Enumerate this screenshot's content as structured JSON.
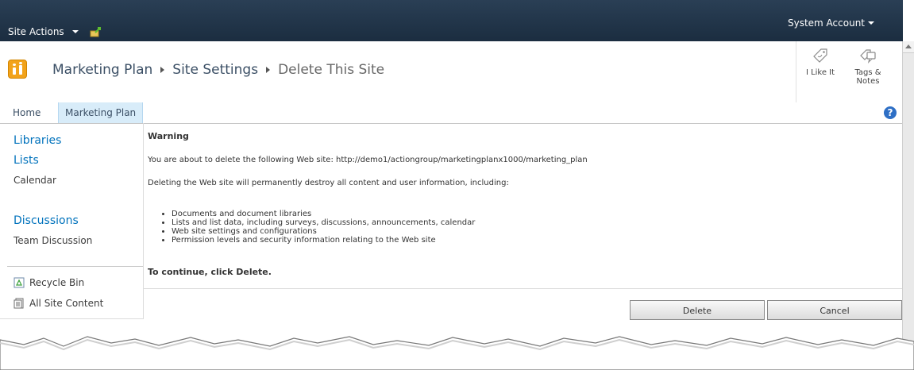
{
  "topbar": {
    "site_actions": "Site Actions",
    "user": "System Account"
  },
  "title": {
    "breadcrumb": [
      "Marketing Plan",
      "Site Settings",
      "Delete This Site"
    ],
    "social": {
      "like": "I Like It",
      "tags_line1": "Tags &",
      "tags_line2": "Notes"
    }
  },
  "topnav": {
    "tabs": [
      "Home",
      "Marketing Plan"
    ],
    "help": "?"
  },
  "leftnav": {
    "libraries": "Libraries",
    "lists": "Lists",
    "calendar": "Calendar",
    "discussions": "Discussions",
    "team_discussion": "Team Discussion",
    "recycle_bin": "Recycle Bin",
    "all_site_content": "All Site Content"
  },
  "main": {
    "warning_title": "Warning",
    "about_to_delete": "You are about to delete the following Web site: http://demo1/actiongroup/marketingplanx1000/marketing_plan",
    "permanently": "Deleting the Web site will permanently destroy all content and user information, including:",
    "bullets": [
      "Documents and document libraries",
      "Lists and list data, including surveys, discussions, announcements, calendar",
      "Web site settings and configurations",
      "Permission levels and security information relating to the Web site"
    ],
    "continue": "To continue, click Delete.",
    "delete_label": "Delete",
    "cancel_label": "Cancel"
  },
  "colors": {
    "topbar": "#21374c",
    "link": "#0072bc",
    "logo": "#f2a31b",
    "selected_tab": "#d8ecf9"
  }
}
